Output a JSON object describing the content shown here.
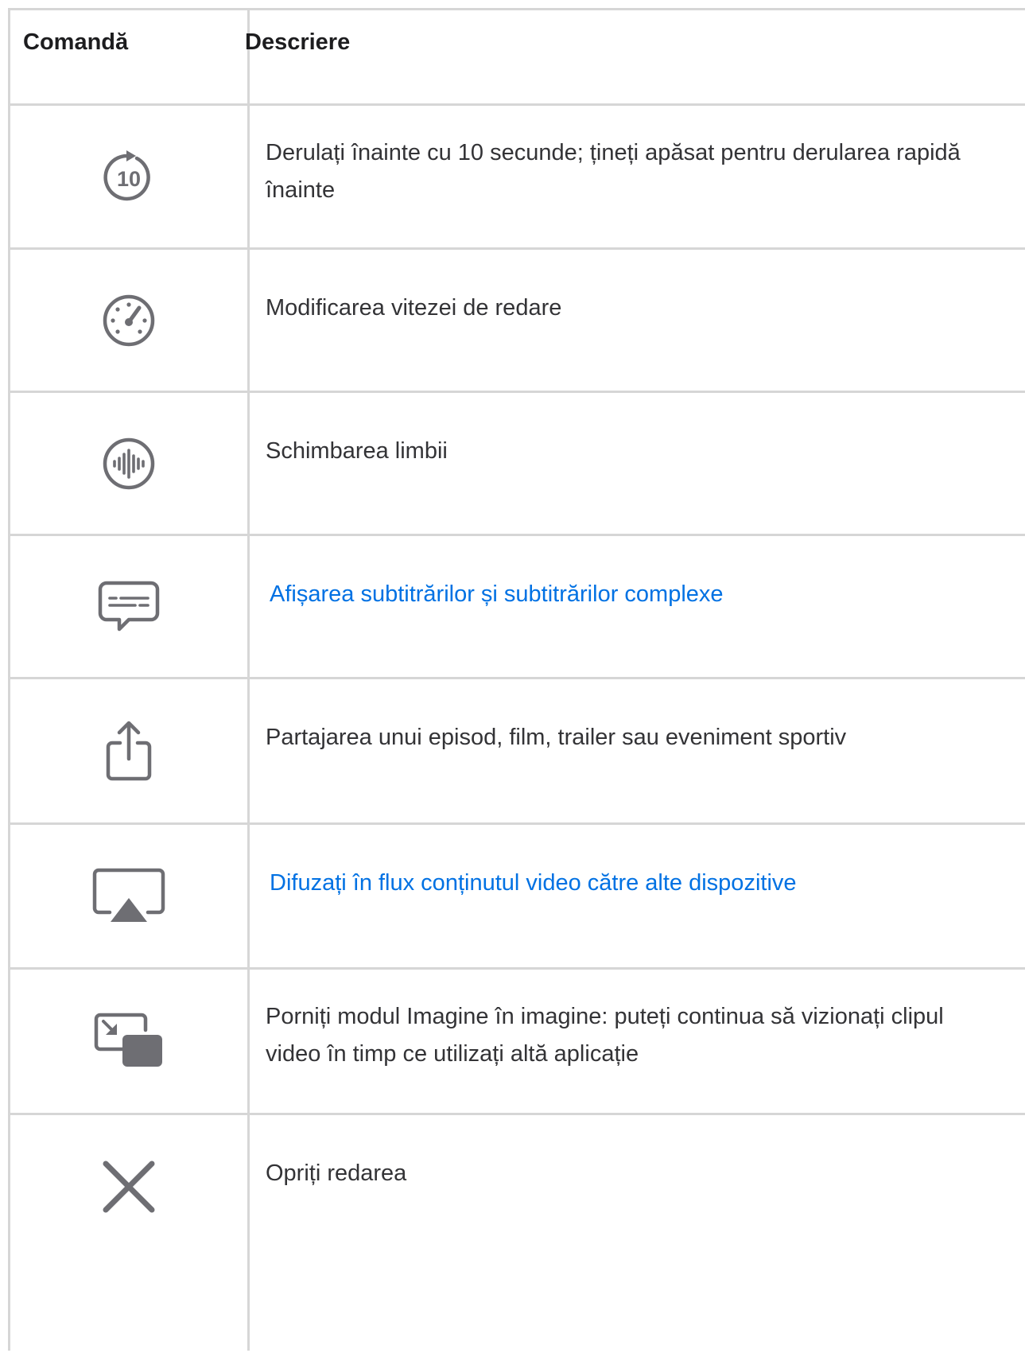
{
  "header": {
    "col_command": "Comandă",
    "col_description": "Descriere"
  },
  "rows": [
    {
      "icon": "skip-forward-10-icon",
      "icon_text": "10",
      "description": "Derulați înainte cu 10 secunde; țineți apăsat pentru derularea rapidă înainte",
      "is_link": false
    },
    {
      "icon": "speedometer-icon",
      "description": "Modificarea vitezei de redare",
      "is_link": false
    },
    {
      "icon": "audio-waveform-icon",
      "description": "Schimbarea limbii",
      "is_link": false
    },
    {
      "icon": "subtitles-bubble-icon",
      "description": "Afișarea subtitrărilor și subtitrărilor complexe",
      "is_link": true
    },
    {
      "icon": "share-icon",
      "description": "Partajarea unui episod, film, trailer sau eveniment sportiv",
      "is_link": false
    },
    {
      "icon": "airplay-icon",
      "description": "Difuzați în flux conținutul video către alte dispozitive",
      "is_link": true
    },
    {
      "icon": "picture-in-picture-icon",
      "description": "Porniți modul Imagine în imagine: puteți continua să vizionați clipul video în timp ce utilizați altă aplicație",
      "is_link": false
    },
    {
      "icon": "close-x-icon",
      "description": "Opriți redarea",
      "is_link": false
    }
  ],
  "colors": {
    "icon": "#6e6e73",
    "link": "#0071e3",
    "border": "#d6d6d6",
    "text": "#333336"
  }
}
